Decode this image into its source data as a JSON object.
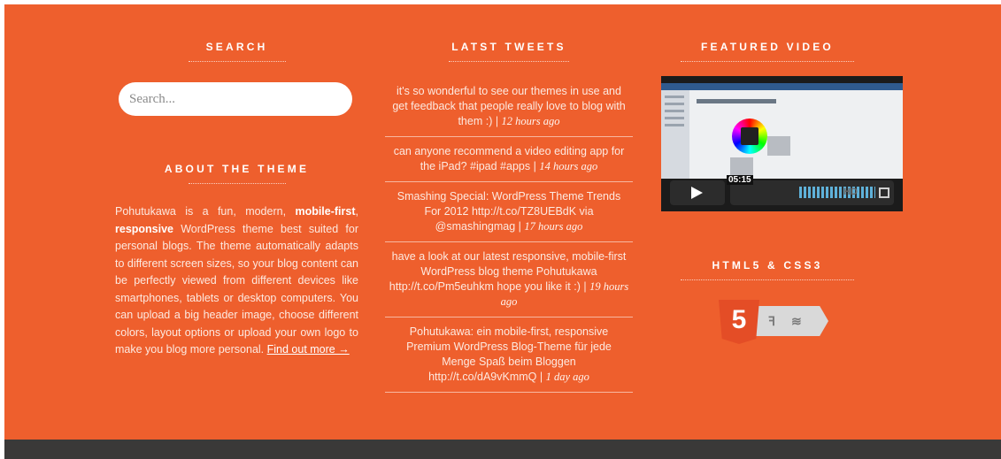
{
  "search": {
    "title": "SEARCH",
    "placeholder": "Search..."
  },
  "about": {
    "title": "ABOUT THE THEME",
    "text_1": "Pohutukawa is a fun, modern, ",
    "bold_1": "mobile-first",
    "text_2": ", ",
    "bold_2": "responsive",
    "text_3": " WordPress theme best suited for personal blogs. The theme automatically adapts to different screen sizes, so your blog content can be perfectly viewed from different devices like smartphones, tablets or desktop computers. You can upload a big header image, choose different colors, layout options or upload your own logo to make you blog more personal. ",
    "link": "Find out more →"
  },
  "tweets": {
    "title": "LATST TWEETS",
    "items": [
      {
        "text": "it's so wonderful to see our themes in use and get feedback that people really love to blog with them :) | ",
        "time": "12 hours ago"
      },
      {
        "text": "can anyone recommend a video editing app for the iPad? #ipad #apps | ",
        "time": "14 hours ago"
      },
      {
        "text": "Smashing Special: WordPress Theme Trends For 2012 http://t.co/TZ8UEBdK via @smashingmag | ",
        "time": "17 hours ago"
      },
      {
        "text": "have a look at our latest responsive, mobile-first WordPress blog theme Pohutukawa http://t.co/Pm5euhkm hope you like it :) | ",
        "time": "19 hours ago"
      },
      {
        "text": "Pohutukawa: ein mobile-first, responsive Premium WordPress Blog-Theme für jede Menge Spaß beim Bloggen http://t.co/dA9vKmmQ | ",
        "time": "1 day ago"
      }
    ]
  },
  "video": {
    "title": "FEATURED VIDEO",
    "time": "05:15",
    "hd": "HD",
    "brand": "vimeo"
  },
  "html5": {
    "title": "HTML5 & CSS3",
    "badge_digit": "5"
  },
  "colors": {
    "background": "#ee5f2d",
    "footer": "#3a3938",
    "text": "#fde9e0"
  }
}
